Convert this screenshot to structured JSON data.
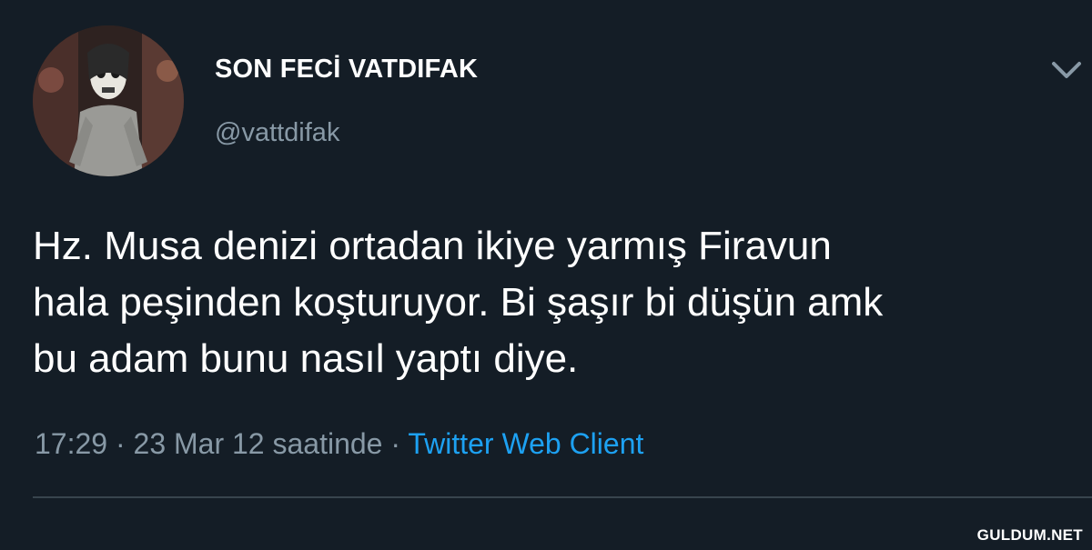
{
  "tweet": {
    "display_name": "SON FECİ VATDIFAK",
    "handle": "@vattdifak",
    "text_lines": [
      "Hz. Musa denizi ortadan ikiye yarmış Firavun",
      "hala peşinden koşturuyor. Bi şaşır bi düşün amk",
      "bu adam bunu nasıl yaptı diye."
    ],
    "timestamp": "17:29 · 23 Mar 12 saatinde ·",
    "source": "Twitter Web Client",
    "caret_icon": "chevron-down-icon"
  },
  "watermark": "GULDUM.NET",
  "colors": {
    "background": "#141d26",
    "secondary_text": "#8899a6",
    "link": "#1da1f2",
    "divider": "#38444d"
  }
}
